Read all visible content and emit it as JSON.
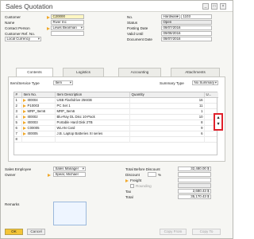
{
  "window": {
    "title": "Sales Quotation"
  },
  "header_left": {
    "customer_label": "Customer",
    "customer_value": "C20000",
    "name_label": "Name",
    "name_value": "River Inc",
    "contact_label": "Contact Person",
    "contact_value": "Lewis Bearman",
    "customer_ref_label": "Customer Ref. No.",
    "customer_ref_value": "",
    "currency_value": "Local Currency"
  },
  "header_right": {
    "no_label": "No.",
    "series_value": "Hardware",
    "no_value": "1103",
    "status_label": "Status",
    "status_value": "Open",
    "posting_date_label": "Posting Date",
    "posting_date_value": "08/07/2016",
    "valid_until_label": "Valid Until",
    "valid_until_value": "09/08/2016",
    "document_date_label": "Document Date",
    "document_date_value": "08/07/2016"
  },
  "tabs": [
    {
      "label": "Contents"
    },
    {
      "label": "Logistics"
    },
    {
      "label": "Accounting"
    },
    {
      "label": "Attachments"
    }
  ],
  "contents": {
    "item_service_type_label": "Item/Service Type",
    "item_service_type_value": "Item",
    "summary_type_label": "Summary Type",
    "summary_type_value": "No Summary"
  },
  "table": {
    "headers": [
      "#",
      "Item No.",
      "Item Description",
      "Quantity",
      "U..."
    ],
    "rows": [
      {
        "n": "1",
        "item_no": "I00004",
        "description": "USB Flashdrive 256GB",
        "quantity": "16"
      },
      {
        "n": "2",
        "item_no": "P10003",
        "description": "PC Set 1",
        "quantity": "11"
      },
      {
        "n": "3",
        "item_no": "MRP_Item6",
        "description": "MRP_Item6",
        "quantity": "1"
      },
      {
        "n": "4",
        "item_no": "I00002",
        "description": "Blu-Ray DL Disc 10-Pack",
        "quantity": "10"
      },
      {
        "n": "5",
        "item_no": "I00003",
        "description": "Portable Hard Disk 2TB",
        "quantity": "8"
      },
      {
        "n": "6",
        "item_no": "C00005",
        "description": "WLAN Card",
        "quantity": "9"
      },
      {
        "n": "7",
        "item_no": "I00005",
        "description": "J.B. Laptop Batteries XI series",
        "quantity": "6"
      },
      {
        "n": "8",
        "item_no": "",
        "description": "",
        "quantity": ""
      }
    ]
  },
  "row_move": {
    "up_icon": "arrow-up-icon",
    "down_icon": "arrow-down-icon"
  },
  "footer_left": {
    "sales_employee_label": "Sales Employee",
    "sales_employee_value": "Sales Manager",
    "owner_label": "Owner",
    "owner_value": "Spear, Michael",
    "remarks_label": "Remarks",
    "remarks_value": ""
  },
  "totals": {
    "total_before_discount_label": "Total Before Discount",
    "total_before_discount_value": "32,480.00 $",
    "discount_label": "Discount",
    "discount_percent_sign": "%",
    "freight_label": "Freight",
    "rounding_label": "Rounding",
    "tax_label": "Tax",
    "tax_value": "2,680.43 $",
    "total_label": "Total",
    "total_value": "35,170.43 $"
  },
  "buttons": {
    "ok": "OK",
    "cancel": "Cancel",
    "copy_from": "Copy From",
    "copy_to": "Copy To"
  },
  "colors": {
    "accent_button": "#f4c537",
    "link_arrow": "#f0a82a",
    "highlight_box": "#e0202a",
    "mandatory_field": "#fff7c2"
  }
}
